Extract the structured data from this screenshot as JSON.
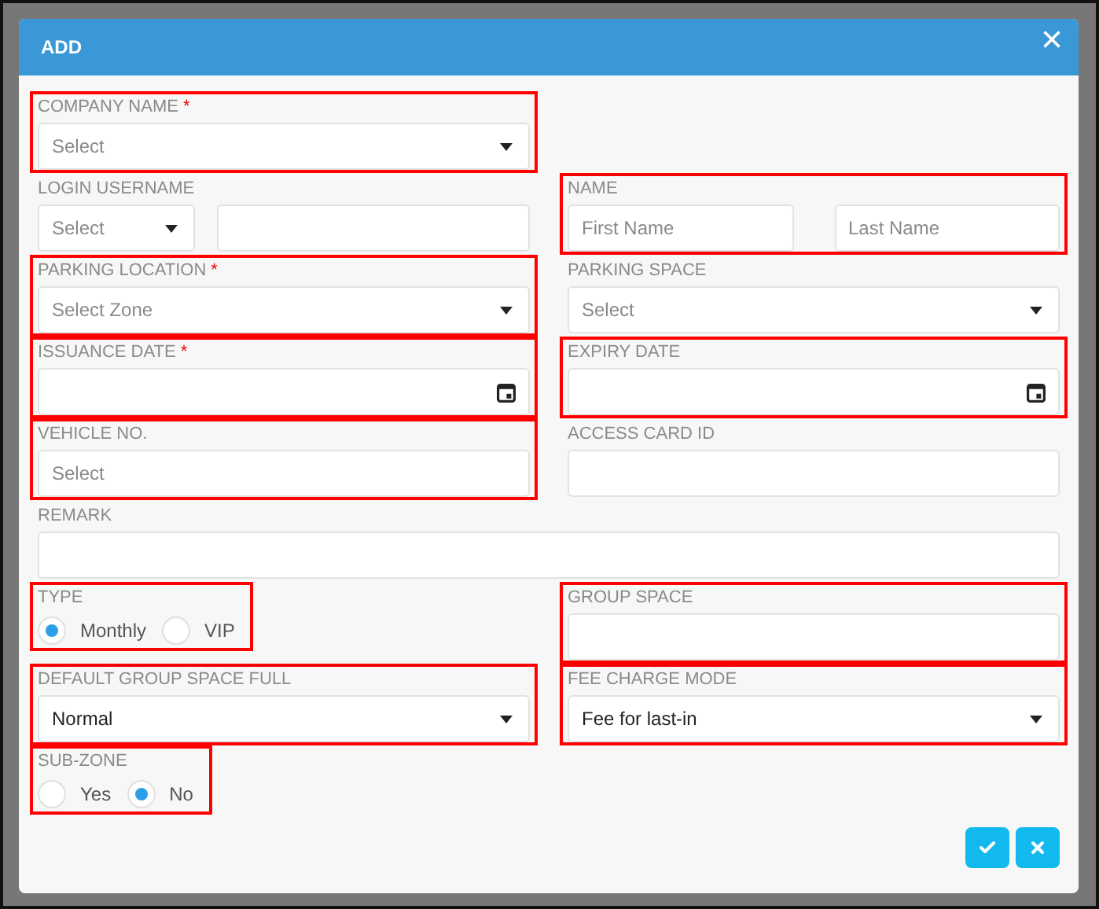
{
  "dialog": {
    "title": "ADD",
    "close_label": "×"
  },
  "rows": [
    {
      "left": {
        "kind": "select",
        "label": "COMPANY NAME",
        "required_mark": "*",
        "highlighted": true,
        "placeholder": "Select"
      }
    },
    {
      "left": {
        "kind": "select-text",
        "label": "LOGIN USERNAME",
        "highlighted": false,
        "placeholder": "Select"
      },
      "right": {
        "kind": "pair",
        "label": "NAME",
        "highlighted": true,
        "placeholders": [
          "First Name",
          "Last Name"
        ]
      }
    },
    {
      "left": {
        "kind": "select",
        "label": "PARKING LOCATION",
        "required_mark": "*",
        "highlighted": true,
        "placeholder": "Select Zone"
      },
      "right": {
        "kind": "select",
        "label": "PARKING SPACE",
        "highlighted": false,
        "placeholder": "Select"
      }
    },
    {
      "left": {
        "kind": "date",
        "label": "ISSUANCE DATE",
        "required_mark": "*",
        "highlighted": true
      },
      "right": {
        "kind": "date",
        "label": "EXPIRY DATE",
        "highlighted": true
      }
    },
    {
      "left": {
        "kind": "text",
        "label": "VEHICLE NO.",
        "highlighted": true,
        "placeholder": "Select"
      },
      "right": {
        "kind": "text",
        "label": "ACCESS CARD ID",
        "highlighted": false
      }
    },
    {
      "full": {
        "kind": "text",
        "label": "REMARK",
        "highlighted": false
      }
    },
    {
      "left": {
        "kind": "radio",
        "label": "TYPE",
        "highlighted": true,
        "options": [
          {
            "label": "Monthly",
            "selected": true
          },
          {
            "label": "VIP",
            "selected": false
          }
        ]
      },
      "right": {
        "kind": "text",
        "label": "GROUP SPACE",
        "highlighted": true
      }
    },
    {
      "left": {
        "kind": "select",
        "label": "DEFAULT GROUP SPACE FULL",
        "highlighted": true,
        "value": "Normal"
      },
      "right": {
        "kind": "select",
        "label": "FEE CHARGE MODE",
        "highlighted": true,
        "value": "Fee for last-in"
      }
    },
    {
      "left": {
        "kind": "radio",
        "label": "SUB-ZONE",
        "highlighted": true,
        "options": [
          {
            "label": "Yes",
            "selected": false
          },
          {
            "label": "No",
            "selected": true
          }
        ]
      }
    }
  ],
  "actions": [
    {
      "kind": "confirm"
    },
    {
      "kind": "cancel"
    }
  ]
}
